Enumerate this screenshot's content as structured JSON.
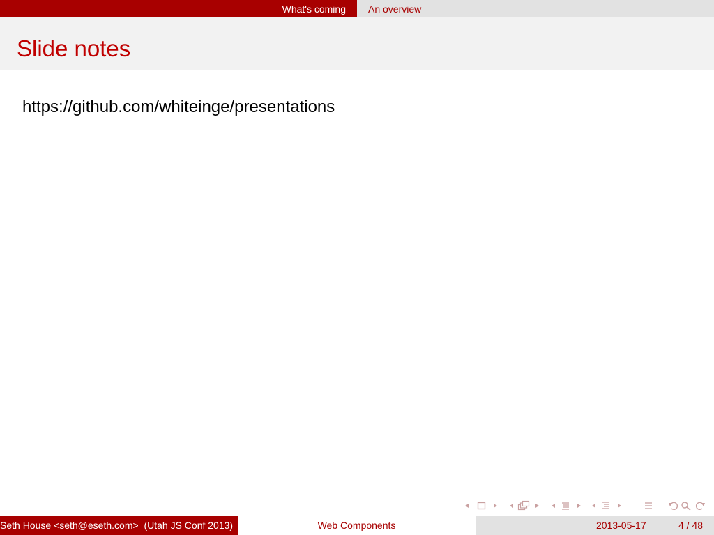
{
  "nav": {
    "sections": [
      {
        "label": "What's coming"
      },
      {
        "label": "An overview"
      }
    ]
  },
  "frame": {
    "title": "Slide notes",
    "body": "https://github.com/whiteinge/presentations"
  },
  "footer": {
    "author": "Seth House <seth@eseth.com>",
    "institute": "(Utah JS Conf 2013)",
    "short_title": "Web Components",
    "date": "2013-05-17",
    "page": "4 / 48"
  },
  "colors": {
    "accent": "#a80000",
    "title": "#c00000",
    "gray": "#e2e2e2",
    "title_band": "#f2f2f2",
    "nav_symbols": "#c9a0a0"
  },
  "icons": [
    "arrow-left-icon",
    "frame-icon",
    "arrow-right-icon",
    "arrow-left-icon",
    "subsection-icon",
    "arrow-right-icon",
    "arrow-left-icon",
    "section-icon",
    "arrow-right-icon",
    "arrow-left-icon",
    "document-icon",
    "arrow-right-icon",
    "align-icon",
    "undo-icon",
    "search-icon",
    "redo-icon"
  ]
}
